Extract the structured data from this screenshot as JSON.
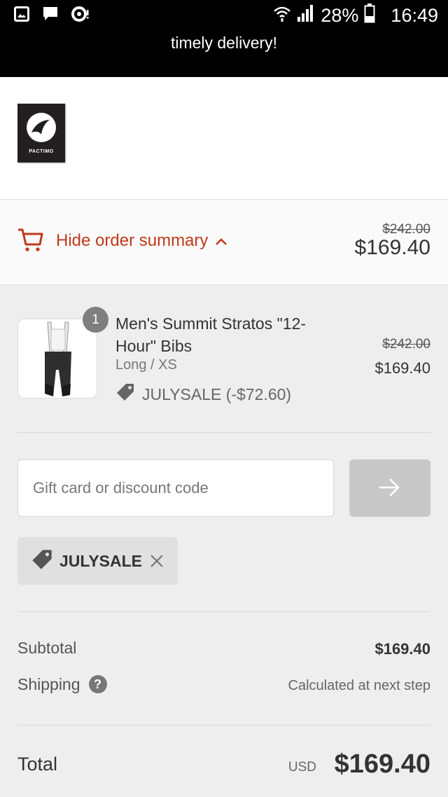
{
  "status_bar": {
    "battery": "28%",
    "time": "16:49",
    "icons": [
      "image-icon",
      "chat-icon",
      "notification-icon",
      "wifi-icon",
      "signal-icon",
      "battery-icon"
    ]
  },
  "banner": {
    "text": "timely delivery!"
  },
  "brand": {
    "logo_text": "PACTIMO"
  },
  "summary_toggle": {
    "label": "Hide order summary",
    "original_price": "$242.00",
    "price": "$169.40",
    "accent_color": "#c0391b"
  },
  "product": {
    "quantity": "1",
    "name": "Men's Summit Stratos \"12-Hour\" Bibs",
    "variant": "Long / XS",
    "discount": "JULYSALE (-$72.60)",
    "original_price": "$242.00",
    "price": "$169.40"
  },
  "discount_form": {
    "placeholder": "Gift card or discount code",
    "applied_code": "JULYSALE"
  },
  "totals": {
    "subtotal_label": "Subtotal",
    "subtotal_value": "$169.40",
    "shipping_label": "Shipping",
    "shipping_value": "Calculated at next step",
    "help_glyph": "?",
    "total_label": "Total",
    "currency": "USD",
    "total_value": "$169.40"
  }
}
